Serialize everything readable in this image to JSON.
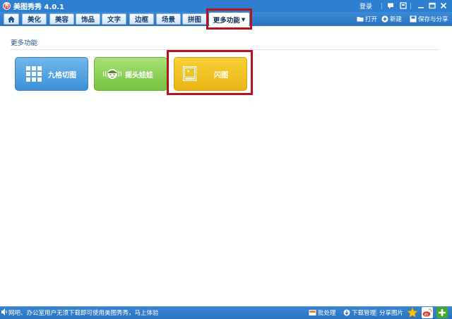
{
  "app": {
    "title": "美图秀秀 4.0.1",
    "logo_text": "秀"
  },
  "titlebar": {
    "login": "登录"
  },
  "tabs": [
    {
      "id": "home",
      "label": ""
    },
    {
      "id": "beautify",
      "label": "美化"
    },
    {
      "id": "makeup",
      "label": "美容"
    },
    {
      "id": "accessories",
      "label": "饰品"
    },
    {
      "id": "text",
      "label": "文字"
    },
    {
      "id": "border",
      "label": "边框"
    },
    {
      "id": "scene",
      "label": "场景"
    },
    {
      "id": "collage",
      "label": "拼图"
    },
    {
      "id": "more",
      "label": "更多功能"
    }
  ],
  "toolbar_right": {
    "open": "打开",
    "new": "新建",
    "save_share": "保存与分享"
  },
  "section": {
    "title": "更多功能"
  },
  "features": {
    "grid": "九格切图",
    "shake": "摇头娃娃",
    "flash": "闪图"
  },
  "status": {
    "message": "网吧、办公室用户无须下载即可使用美图秀秀，马上体验",
    "batch": "批处理",
    "downloads": "下载管理",
    "share": "分享图片"
  },
  "colors": {
    "titlebar": "#2f7fd0",
    "highlight": "#b5121b",
    "grid_button": "#4b9ae0",
    "shake_button": "#86cc4e",
    "flash_button": "#f0c023"
  },
  "icons": [
    "app-logo-icon",
    "speaker-icon",
    "home-icon",
    "grid-icon",
    "doll-icon",
    "image-icon",
    "open-folder-icon",
    "new-plus-icon",
    "save-icon",
    "batch-icon",
    "download-icon",
    "star-icon",
    "weibo-icon",
    "add-icon"
  ]
}
